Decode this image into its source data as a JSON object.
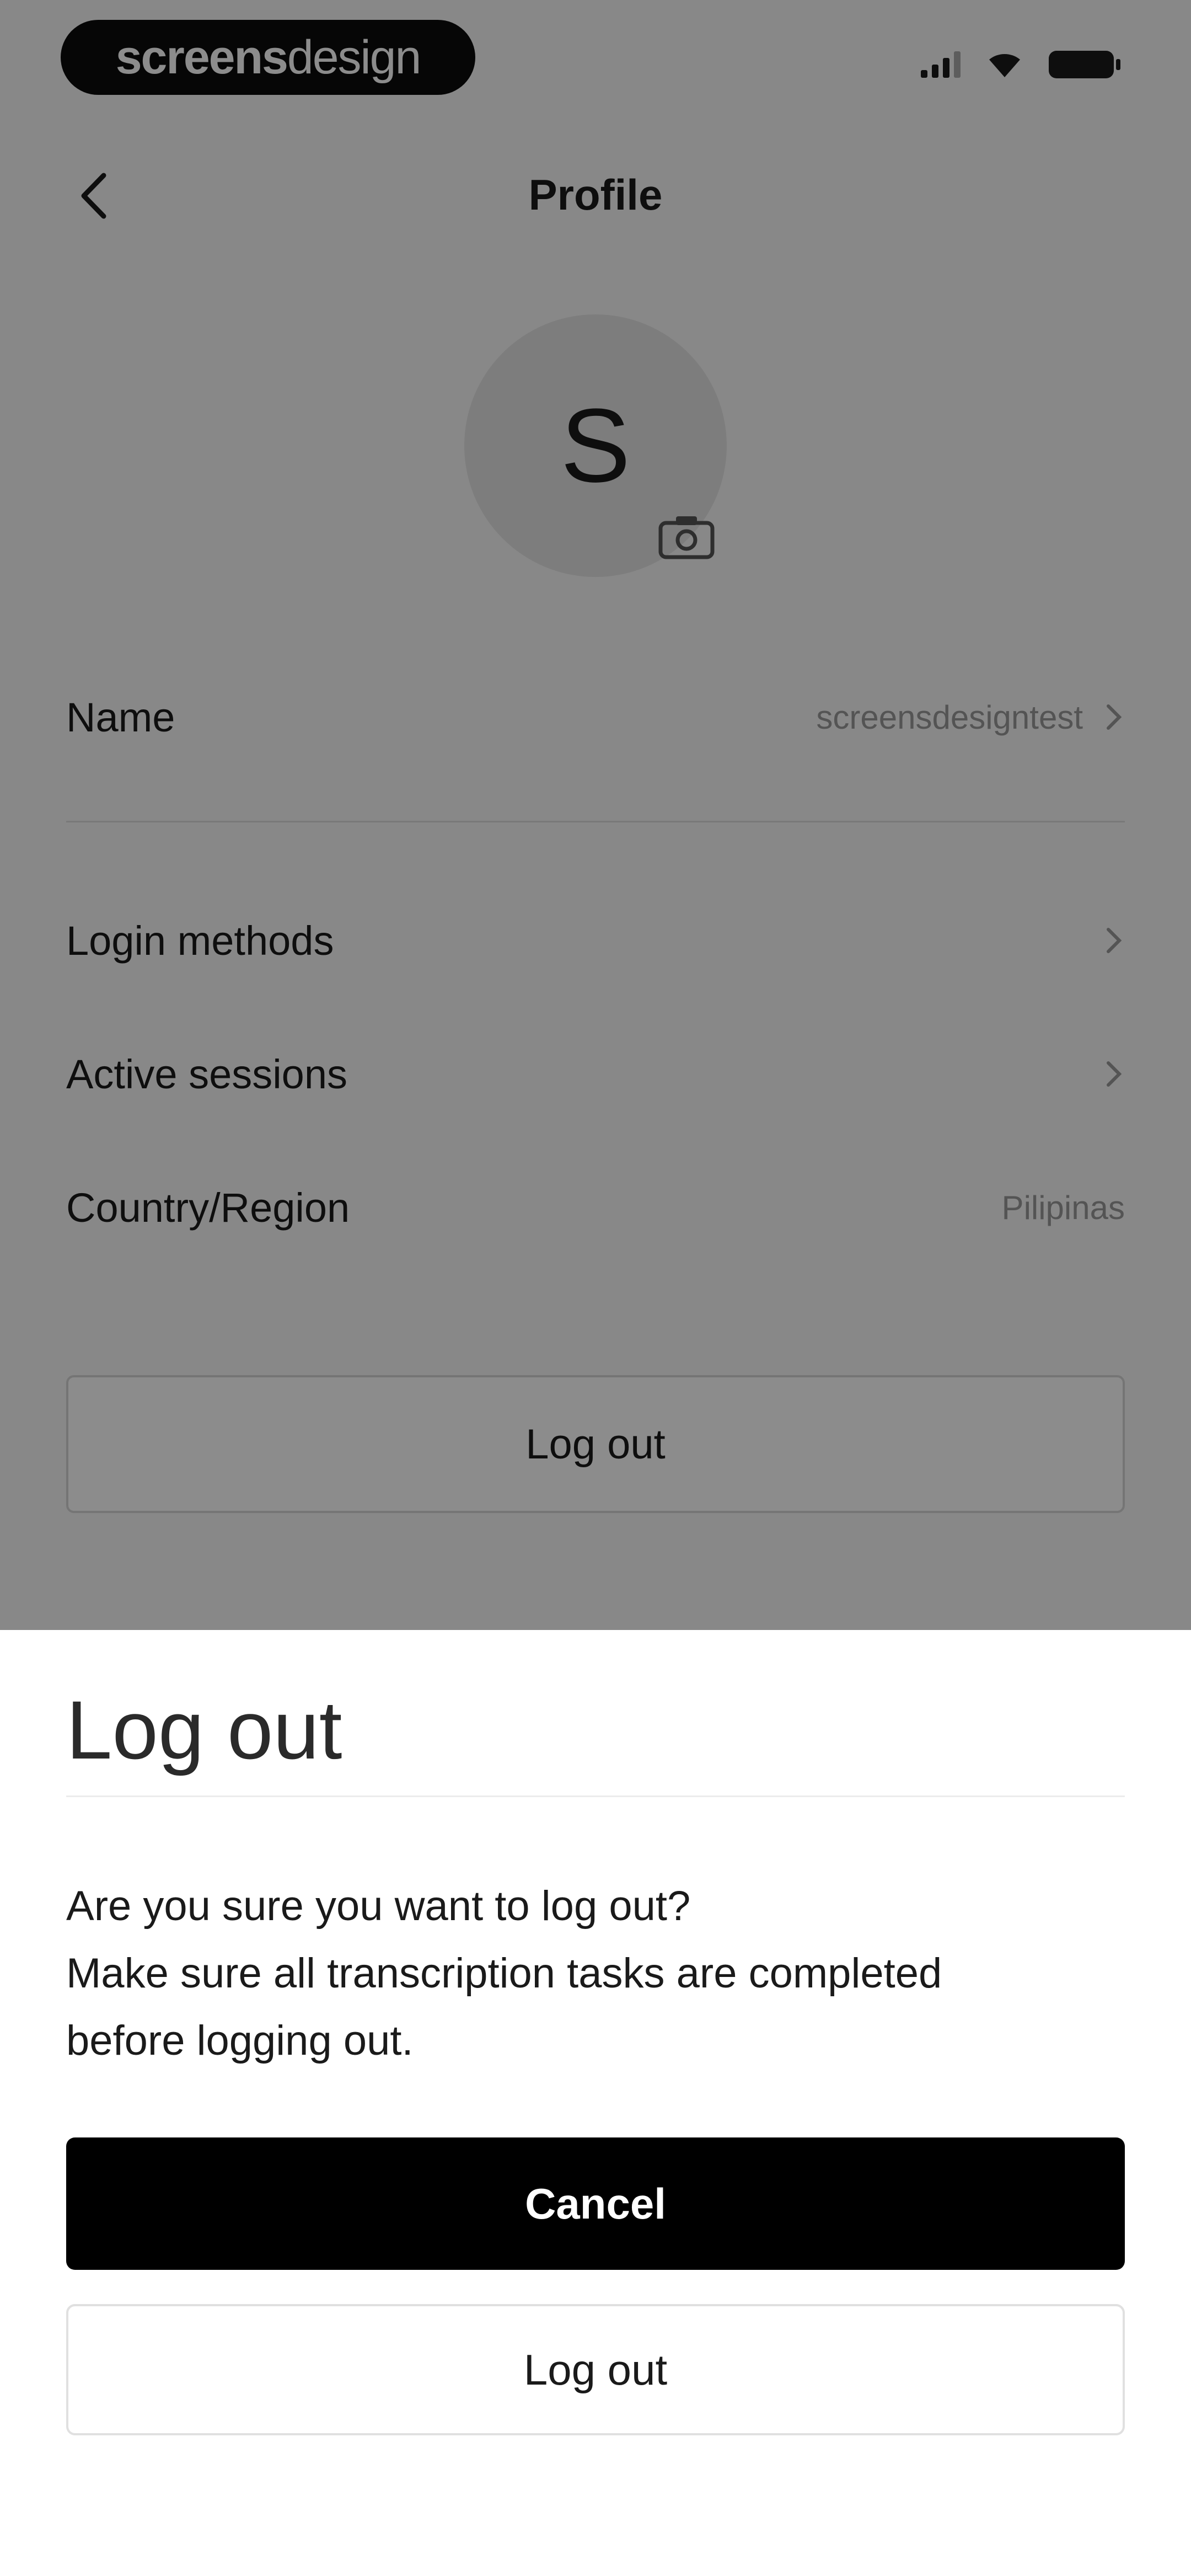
{
  "status_bar": {
    "brand_part1": "screens",
    "brand_part2": "design"
  },
  "header": {
    "title": "Profile"
  },
  "avatar": {
    "initial": "S"
  },
  "rows": [
    {
      "label": "Name",
      "value": "screensdesigntest"
    },
    {
      "label": "Login methods",
      "value": ""
    },
    {
      "label": "Active sessions",
      "value": ""
    },
    {
      "label": "Country/Region",
      "value": "Pilipinas"
    }
  ],
  "logout_button_label": "Log out",
  "dialog": {
    "title": "Log out",
    "message_lines": [
      "Are you sure you want to log out?",
      "Make sure all transcription tasks are completed",
      "before logging out."
    ],
    "cancel_label": "Cancel",
    "confirm_label": "Log out"
  },
  "colors": {
    "primary": "#000000",
    "overlay": "rgba(0,0,0,0.45)"
  }
}
